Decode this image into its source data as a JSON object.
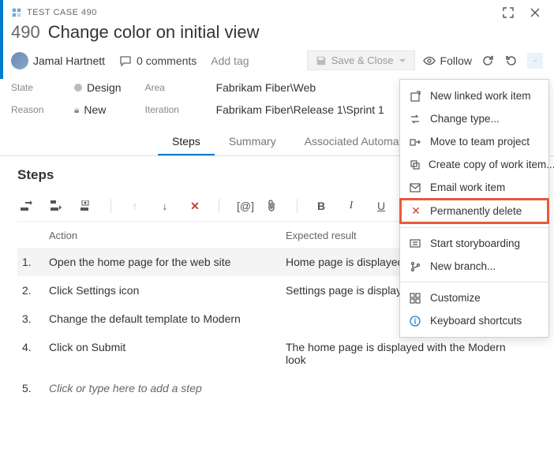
{
  "header": {
    "type_label": "TEST CASE 490",
    "id": "490",
    "title": "Change color on initial view",
    "assignee": "Jamal Hartnett",
    "comments": "0 comments",
    "add_tag": "Add tag",
    "save_label": "Save & Close",
    "follow_label": "Follow"
  },
  "fields": {
    "state_label": "State",
    "state_value": "Design",
    "reason_label": "Reason",
    "reason_value": "New",
    "area_label": "Area",
    "area_value": "Fabrikam Fiber\\Web",
    "iteration_label": "Iteration",
    "iteration_value": "Fabrikam Fiber\\Release 1\\Sprint 1"
  },
  "tabs": {
    "steps": "Steps",
    "summary": "Summary",
    "automation": "Associated Automation"
  },
  "steps": {
    "title": "Steps",
    "col_action": "Action",
    "col_expected": "Expected result",
    "rows": [
      {
        "n": "1.",
        "action": "Open the home page for the web site",
        "expected": "Home page is displayed"
      },
      {
        "n": "2.",
        "action": "Click Settings icon",
        "expected": "Settings page is displayed"
      },
      {
        "n": "3.",
        "action": "Change the default template to Modern",
        "expected": ""
      },
      {
        "n": "4.",
        "action": "Click on Submit",
        "expected": "The home page is displayed with the Modern look"
      },
      {
        "n": "5.",
        "action": "",
        "expected": ""
      }
    ],
    "placeholder": "Click or type here to add a step"
  },
  "menu": {
    "new_linked": "New linked work item",
    "change_type": "Change type...",
    "move_team": "Move to team project",
    "create_copy": "Create copy of work item...",
    "email": "Email work item",
    "perm_delete": "Permanently delete",
    "storyboard": "Start storyboarding",
    "new_branch": "New branch...",
    "customize": "Customize",
    "shortcuts": "Keyboard shortcuts"
  }
}
